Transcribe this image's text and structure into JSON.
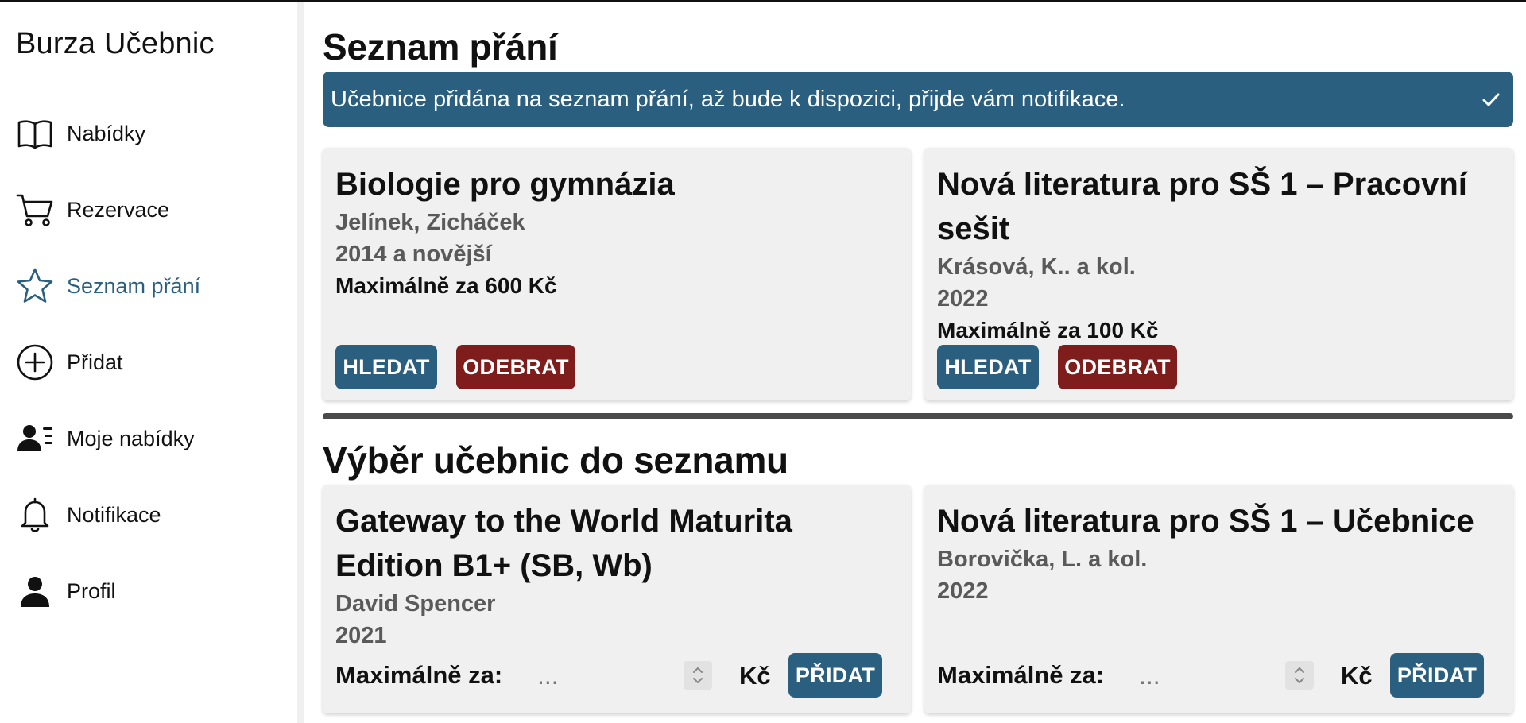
{
  "app": {
    "title": "Burza Učebnic"
  },
  "sidebar": {
    "items": [
      {
        "label": "Nabídky",
        "icon": "book-icon",
        "active": false
      },
      {
        "label": "Rezervace",
        "icon": "cart-icon",
        "active": false
      },
      {
        "label": "Seznam přání",
        "icon": "star-icon",
        "active": true
      },
      {
        "label": "Přidat",
        "icon": "plus-circle-icon",
        "active": false
      },
      {
        "label": "Moje nabídky",
        "icon": "user-list-icon",
        "active": false
      },
      {
        "label": "Notifikace",
        "icon": "bell-icon",
        "active": false
      },
      {
        "label": "Profil",
        "icon": "person-icon",
        "active": false
      }
    ]
  },
  "wishlist": {
    "title": "Seznam přání",
    "notice": "Učebnice přidána na seznam přání, až bude k dispozici, přijde vám notifikace.",
    "items": [
      {
        "title": "Biologie pro gymnázia",
        "authors": "Jelínek, Zicháček",
        "year": "2014 a novější",
        "max_price": "Maximálně za 600 Kč",
        "search_label": "HLEDAT",
        "remove_label": "ODEBRAT"
      },
      {
        "title": "Nová literatura pro SŠ 1 – Pracovní sešit",
        "authors": "Krásová, K.. a kol.",
        "year": "2022",
        "max_price": "Maximálně za 100 Kč",
        "search_label": "HLEDAT",
        "remove_label": "ODEBRAT"
      }
    ]
  },
  "selection": {
    "title": "Výběr učebnic do seznamu",
    "items": [
      {
        "title": "Gateway to the World Maturita Edition B1+ (SB, Wb)",
        "authors": "David Spencer",
        "year": "2021",
        "price_label": "Maximálně za:",
        "price_placeholder": "...",
        "currency": "Kč",
        "add_label": "PŘIDAT"
      },
      {
        "title": "Nová literatura pro SŠ 1 – Učebnice",
        "authors": "Borovička, L. a kol.",
        "year": "2022",
        "price_label": "Maximálně za:",
        "price_placeholder": "...",
        "currency": "Kč",
        "add_label": "PŘIDAT"
      }
    ]
  },
  "colors": {
    "accent": "#2a5f80",
    "danger": "#7f1d1d",
    "card_bg": "#f0f0f0"
  }
}
